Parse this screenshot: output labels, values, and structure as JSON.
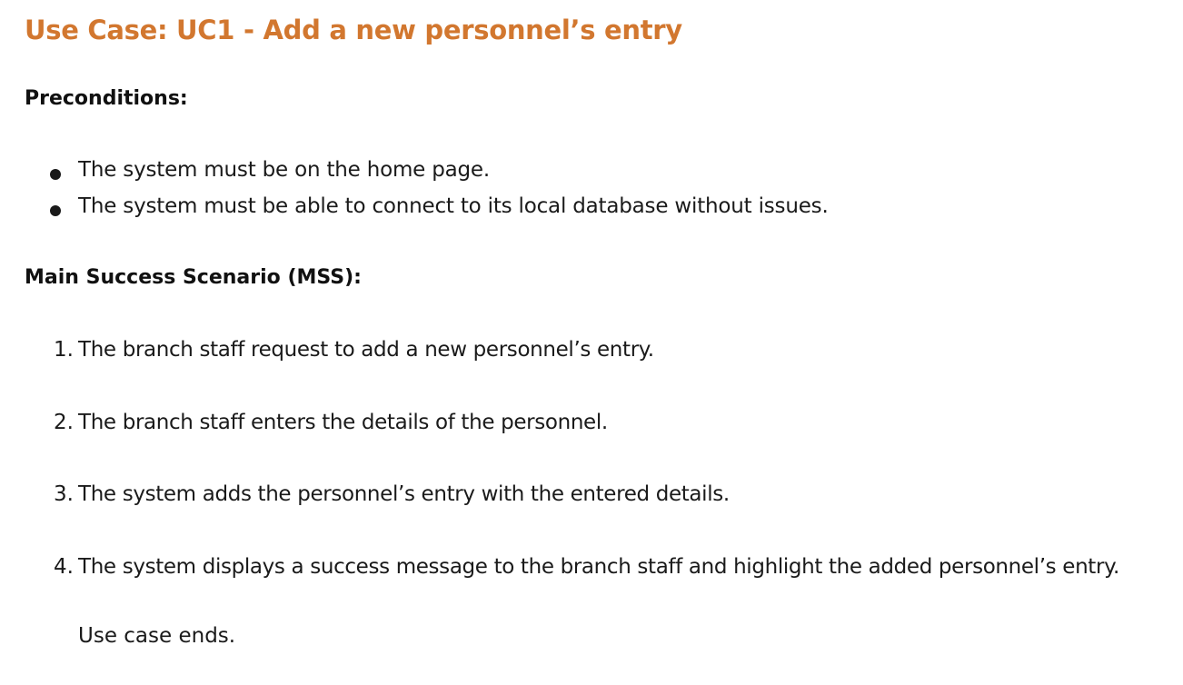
{
  "document": {
    "title": "Use Case: UC1 - Add a new personnel’s entry",
    "preconditions_heading": "Preconditions:",
    "preconditions": [
      "The system must be on the home page.",
      "The system must be able to connect to its local database without issues."
    ],
    "mss_heading": "Main Success Scenario (MSS):",
    "mss_steps": [
      {
        "number": "1.",
        "text": "The branch staff request to add a new personnel’s entry."
      },
      {
        "number": "2.",
        "text": "The branch staff enters the details of the personnel."
      },
      {
        "number": "3.",
        "text": "The system adds the personnel’s entry with the entered details."
      },
      {
        "number": "4.",
        "text": "The system displays a success message to the branch staff and highlight the added personnel’s entry."
      }
    ],
    "closing": "Use case ends."
  },
  "colors": {
    "title": "#d2772f",
    "text": "#1a1a1a"
  }
}
